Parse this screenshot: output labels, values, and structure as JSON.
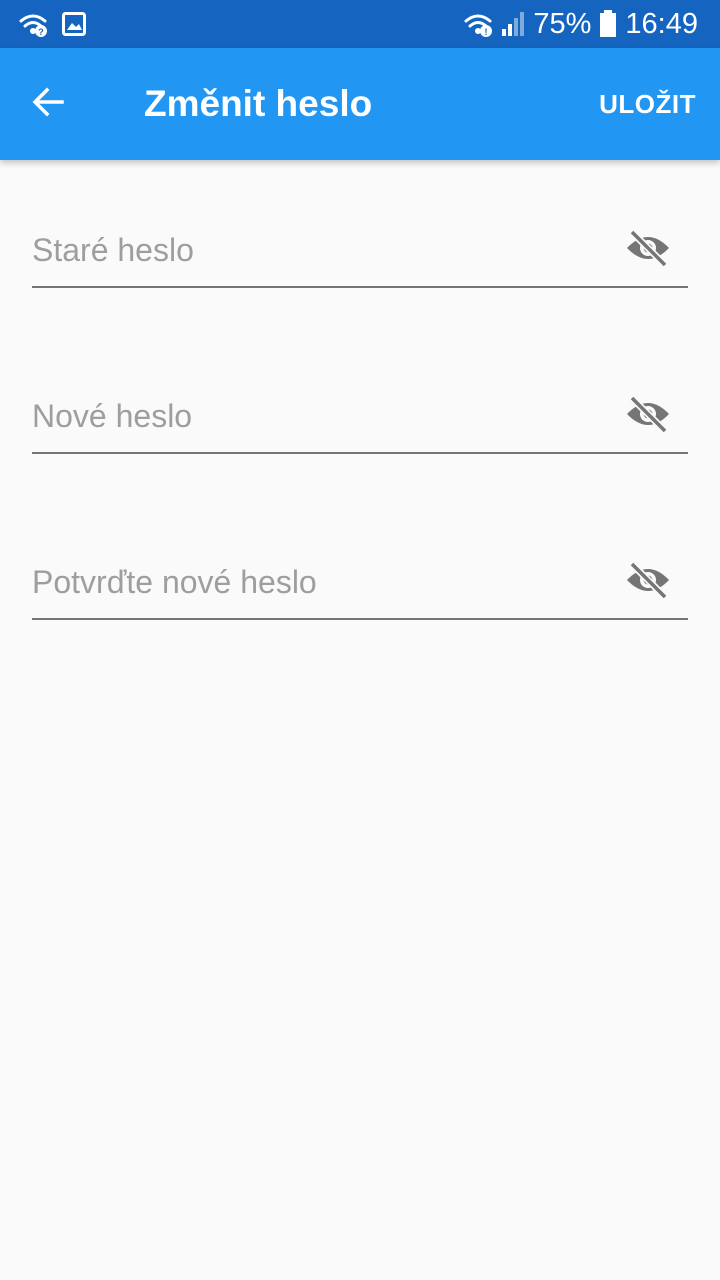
{
  "status_bar": {
    "battery_percent": "75%",
    "time": "16:49",
    "icons": [
      "wifi-icon",
      "gallery-icon",
      "wifi-icon",
      "signal-icon",
      "battery-icon"
    ]
  },
  "app_bar": {
    "title": "Změnit heslo",
    "save_label": "ULOŽIT",
    "back_icon": "arrow-left-icon",
    "background_color": "#2196f3"
  },
  "form": {
    "fields": [
      {
        "placeholder": "Staré heslo",
        "value": "",
        "toggle_icon": "eye-off-icon"
      },
      {
        "placeholder": "Nové heslo",
        "value": "",
        "toggle_icon": "eye-off-icon"
      },
      {
        "placeholder": "Potvrďte nové heslo",
        "value": "",
        "toggle_icon": "eye-off-icon"
      }
    ]
  },
  "colors": {
    "status_bar": "#1565c0",
    "accent": "#2196f3",
    "background": "#fafafa",
    "placeholder": "#9e9e9e",
    "underline": "#757575"
  }
}
